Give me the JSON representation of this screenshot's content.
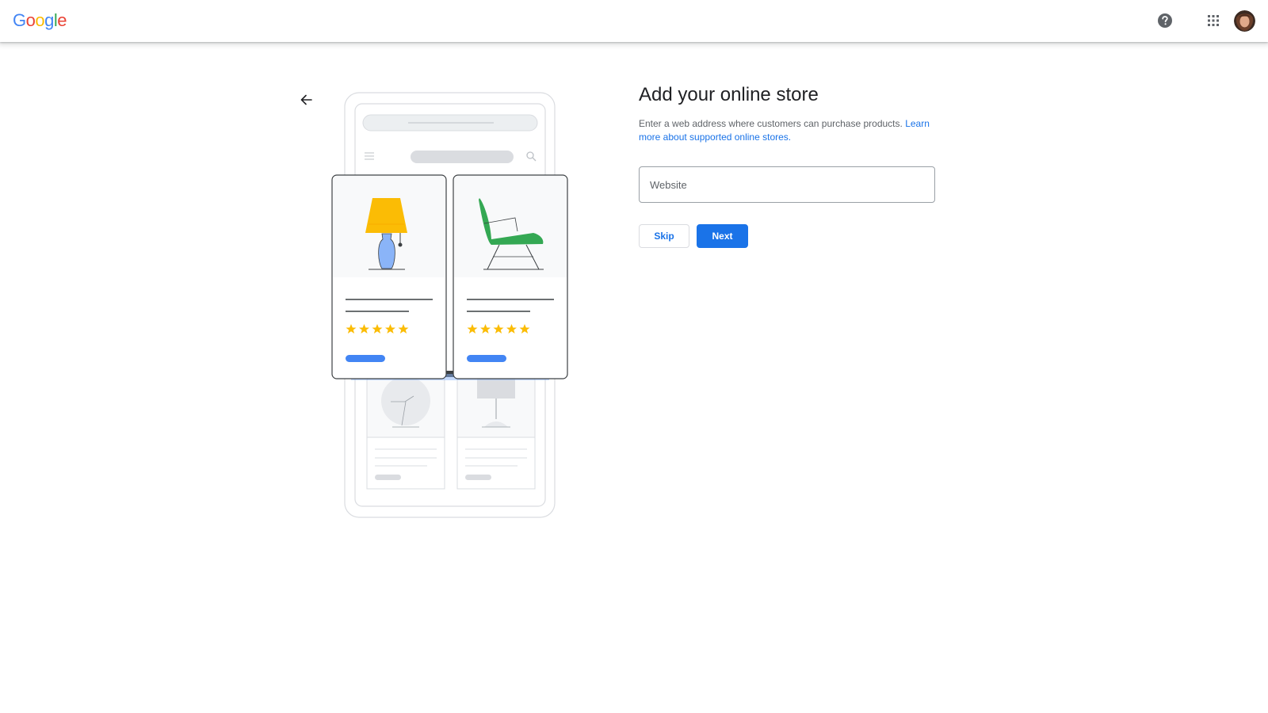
{
  "header": {
    "logo_letters": [
      {
        "char": "G",
        "color": "#4285F4"
      },
      {
        "char": "o",
        "color": "#EA4335"
      },
      {
        "char": "o",
        "color": "#FBBC05"
      },
      {
        "char": "g",
        "color": "#4285F4"
      },
      {
        "char": "l",
        "color": "#34A853"
      },
      {
        "char": "e",
        "color": "#EA4335"
      }
    ],
    "icons": [
      "help-icon",
      "apps-grid-icon",
      "avatar"
    ]
  },
  "main": {
    "back_icon": "arrow-back-icon",
    "title": "Add your online store",
    "description": "Enter a web address where customers can purchase products.",
    "learn_more_link": "Learn more about supported online stores.",
    "website_input": {
      "placeholder": "Website",
      "value": ""
    },
    "skip_label": "Skip",
    "next_label": "Next"
  },
  "colors": {
    "accent": "#1a73e8",
    "lamp_shade": "#FBBC05",
    "lamp_base": "#8AB4F8",
    "chair": "#34A853",
    "stars": "#FBBC05",
    "card_button": "#4285F4"
  }
}
